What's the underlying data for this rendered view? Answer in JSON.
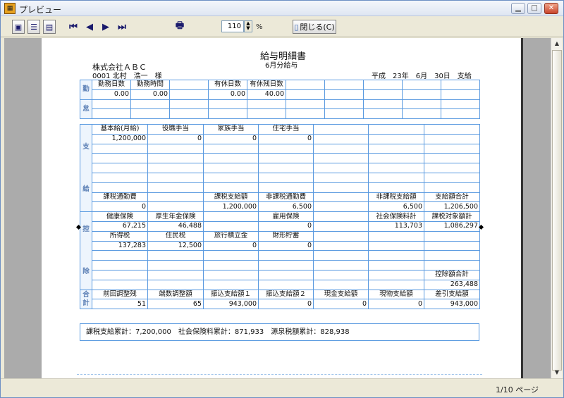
{
  "window": {
    "title": "プレビュー",
    "app_icon": "spreadsheet-icon",
    "minimize_icon": "minimize-icon",
    "maximize_icon": "maximize-icon",
    "close_icon": "close-icon"
  },
  "toolbar": {
    "zoom_value": "110",
    "zoom_unit": "%",
    "close_label": "閉じる(C)"
  },
  "status": {
    "page_info": "1/10 ページ"
  },
  "doc": {
    "title": "給与明細書",
    "subtitle": "6月分給与",
    "company": "株式会社ＡＢＣ",
    "employee_line": "0001 北村　浩一　様",
    "date": "平成　23年　6月　30日　支給",
    "attendance": {
      "side": [
        "勤",
        "怠"
      ],
      "headers": [
        "勤務日数",
        "勤務時間",
        "",
        "有休日数",
        "有休残日数",
        "",
        "",
        "",
        "",
        ""
      ],
      "values": [
        "0.00",
        "0.00",
        "",
        "0.00",
        "40.00",
        "",
        "",
        "",
        "",
        ""
      ]
    },
    "payment": {
      "side": [
        "支",
        "給"
      ],
      "headers": [
        "基本給(月給)",
        "役職手当",
        "家族手当",
        "住宅手当",
        "",
        "",
        "",
        ""
      ],
      "values": [
        "1,200,000",
        "0",
        "0",
        "0",
        "",
        "",
        "",
        ""
      ],
      "headers2": [
        "課税通勤費",
        "",
        "課税支給額",
        "非課税通勤費",
        "",
        "非課税支給額",
        "支給額合計"
      ],
      "values2": [
        "0",
        "",
        "1,200,000",
        "6,500",
        "",
        "6,500",
        "1,206,500"
      ]
    },
    "deduction": {
      "side": [
        "控",
        "除"
      ],
      "headers": [
        "健康保険",
        "厚生年金保険",
        "",
        "雇用保険",
        "",
        "社会保険料計",
        "課税対象額計"
      ],
      "values": [
        "67,215",
        "46,488",
        "",
        "0",
        "",
        "113,703",
        "1,086,297"
      ],
      "headers2": [
        "所得税",
        "住民税",
        "旅行積立金",
        "財形貯蓄",
        "",
        "",
        ""
      ],
      "values2": [
        "137,283",
        "12,500",
        "0",
        "0",
        "",
        "",
        ""
      ],
      "total_label": "控除額合計",
      "total_value": "263,488"
    },
    "totals": {
      "side": [
        "合",
        "計"
      ],
      "headers": [
        "前回調整残",
        "端数調整額",
        "振込支給額１",
        "振込支給額２",
        "現金支給額",
        "現物支給額",
        "差引支給額"
      ],
      "values": [
        "51",
        "65",
        "943,000",
        "0",
        "0",
        "0",
        "943,000"
      ]
    },
    "summary": "課税支給累計：7,200,000　社会保険料累計：871,933　源泉税額累計：828,938"
  }
}
